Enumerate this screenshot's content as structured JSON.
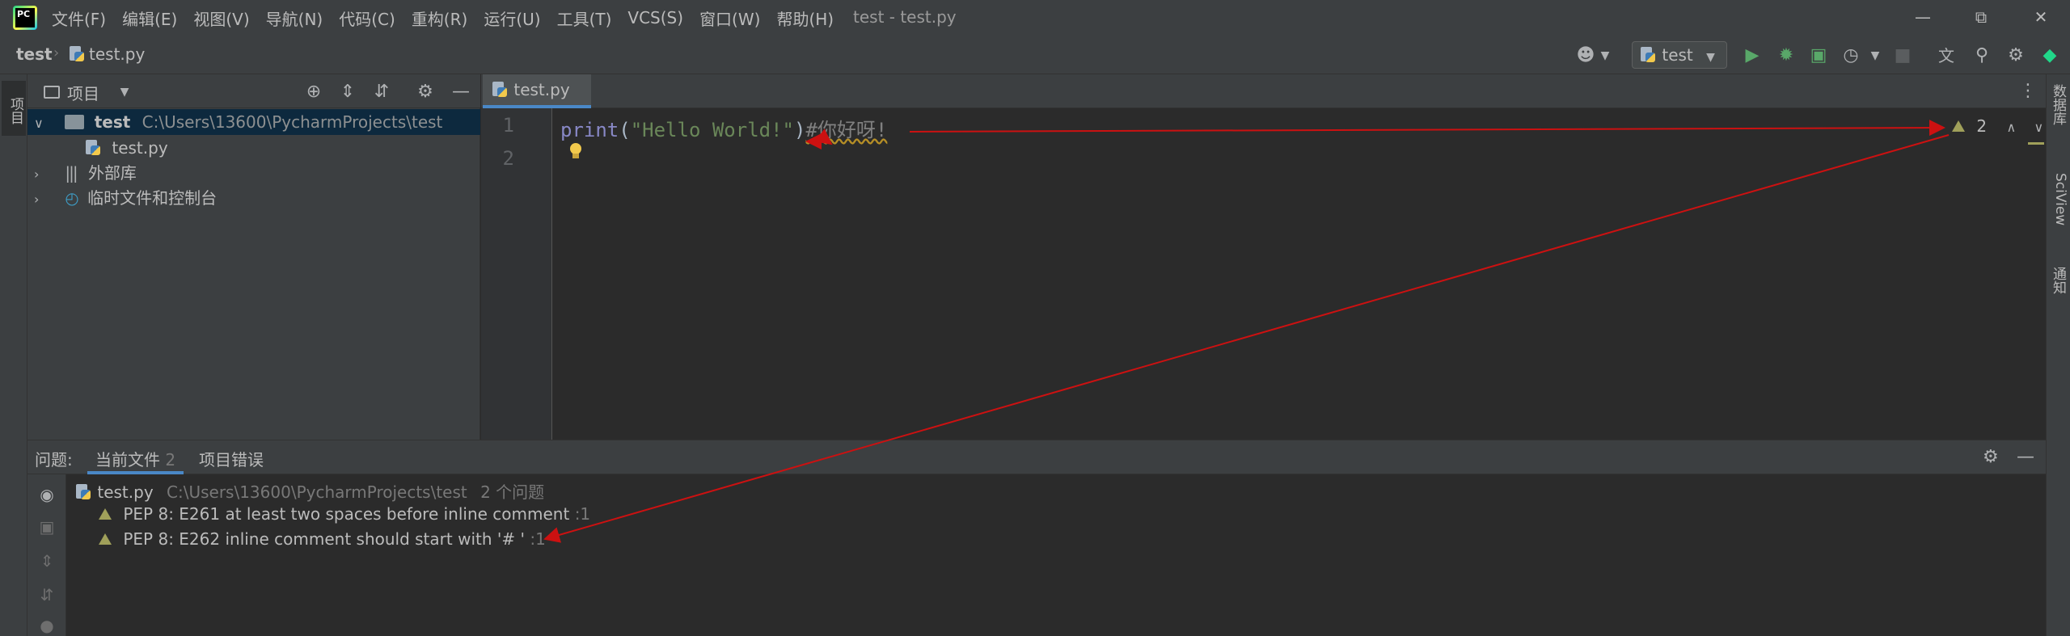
{
  "app": {
    "logo_text": "PC",
    "window_title": "test - test.py"
  },
  "menu": [
    "文件(F)",
    "编辑(E)",
    "视图(V)",
    "导航(N)",
    "代码(C)",
    "重构(R)",
    "运行(U)",
    "工具(T)",
    "VCS(S)",
    "窗口(W)",
    "帮助(H)"
  ],
  "breadcrumb": {
    "project": "test",
    "file": "test.py"
  },
  "toolbar": {
    "run_config": "test"
  },
  "sidebar_tabs": {
    "project": "项目"
  },
  "project_panel": {
    "title": "项目",
    "root_name": "test",
    "root_path": "C:\\Users\\13600\\PycharmProjects\\test",
    "file": "test.py",
    "external_libs": "外部库",
    "scratches": "临时文件和控制台"
  },
  "editor": {
    "tab": "test.py",
    "line_numbers": [
      "1",
      "2"
    ],
    "code": {
      "fn": "print",
      "open": "(",
      "string": "\"Hello World!\"",
      "close": ")",
      "comment": "#你好呀!"
    },
    "warning_count": "2"
  },
  "right_tabs": [
    "数据库",
    "SciView",
    "通知"
  ],
  "problems": {
    "label": "问题:",
    "tab_current": "当前文件",
    "tab_current_count": "2",
    "tab_project": "项目错误",
    "file": "test.py",
    "path": "C:\\Users\\13600\\PycharmProjects\\test",
    "summary": "2 个问题",
    "items": [
      {
        "text": "PEP 8: E261 at least two spaces before inline comment",
        "line": ":1"
      },
      {
        "text": "PEP 8: E262 inline comment should start with '# '",
        "line": ":1"
      }
    ]
  },
  "colors": {
    "annotation_arrow": "#cc1111",
    "selection": "#0d293e",
    "accent": "#4a88c7"
  }
}
